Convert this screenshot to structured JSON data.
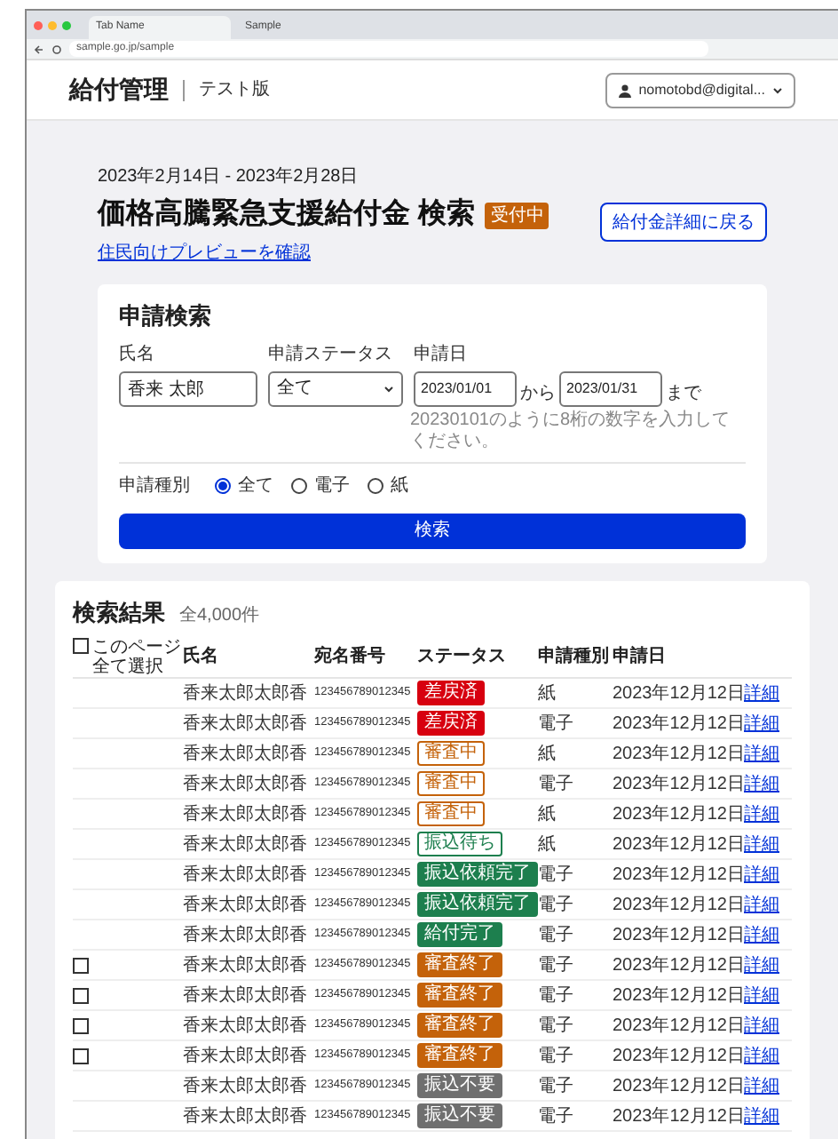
{
  "browser": {
    "tabs": [
      {
        "label": "Tab Name",
        "selected": true
      },
      {
        "label": "Sample",
        "selected": false
      }
    ],
    "url": "sample.go.jp/sample"
  },
  "header": {
    "app_title": "給付管理",
    "edition": "テスト版",
    "user": "nomotobd@digital..."
  },
  "page": {
    "period": "2023年2月14日 - 2023年2月28日",
    "title": "価格高騰緊急支援給付金 検索",
    "badge": "受付中",
    "preview_link": "住民向けプレビューを確認",
    "back_button": "給付金詳細に戻る"
  },
  "search": {
    "title": "申請検索",
    "name_label": "氏名",
    "name_value": "香来 太郎",
    "status_label": "申請ステータス",
    "status_value": "全て",
    "date_label": "申請日",
    "date_from": "2023/01/01",
    "from_text": "から",
    "date_to": "2023/01/31",
    "to_text": "まで",
    "hint": "20230101のように8桁の数字を入力してください。",
    "type_label": "申請種別",
    "type_options": [
      {
        "label": "全て",
        "selected": true
      },
      {
        "label": "電子",
        "selected": false
      },
      {
        "label": "紙",
        "selected": false
      }
    ],
    "submit": "検索"
  },
  "results": {
    "title": "検索結果",
    "count": "全4,000件",
    "select_all": "このページ全て選択",
    "select_all_checked": false,
    "columns": [
      "氏名",
      "宛名番号",
      "ステータス",
      "申請種別",
      "申請日"
    ],
    "rows": [
      {
        "name": "香来太郎太郎香",
        "number": "123456789012345",
        "status": "差戻済",
        "color": "#d7000f",
        "filled": true,
        "type": "紙",
        "date": "2023年12月12日",
        "link": "詳細"
      },
      {
        "name": "香来太郎太郎香",
        "number": "123456789012345",
        "status": "差戻済",
        "color": "#d7000f",
        "filled": true,
        "type": "電子",
        "date": "2023年12月12日",
        "link": "詳細"
      },
      {
        "name": "香来太郎太郎香",
        "number": "123456789012345",
        "status": "審査中",
        "color": "#c4620a",
        "filled": false,
        "type": "紙",
        "date": "2023年12月12日",
        "link": "詳細"
      },
      {
        "name": "香来太郎太郎香",
        "number": "123456789012345",
        "status": "審査中",
        "color": "#c4620a",
        "filled": false,
        "type": "電子",
        "date": "2023年12月12日",
        "link": "詳細"
      },
      {
        "name": "香来太郎太郎香",
        "number": "123456789012345",
        "status": "審査中",
        "color": "#c4620a",
        "filled": false,
        "type": "紙",
        "date": "2023年12月12日",
        "link": "詳細"
      },
      {
        "name": "香来太郎太郎香",
        "number": "123456789012345",
        "status": "振込待ち",
        "color": "#1d7f4e",
        "filled": false,
        "type": "紙",
        "date": "2023年12月12日",
        "link": "詳細"
      },
      {
        "name": "香来太郎太郎香",
        "number": "123456789012345",
        "status": "振込依頼完了",
        "color": "#1d7f4e",
        "filled": true,
        "type": "電子",
        "date": "2023年12月12日",
        "link": "詳細"
      },
      {
        "name": "香来太郎太郎香",
        "number": "123456789012345",
        "status": "振込依頼完了",
        "color": "#1d7f4e",
        "filled": true,
        "type": "電子",
        "date": "2023年12月12日",
        "link": "詳細"
      },
      {
        "name": "香来太郎太郎香",
        "number": "123456789012345",
        "status": "給付完了",
        "color": "#1d7f4e",
        "filled": true,
        "type": "電子",
        "date": "2023年12月12日",
        "link": "詳細"
      },
      {
        "name": "香来太郎太郎香",
        "number": "123456789012345",
        "status": "審査終了",
        "color": "#c4620a",
        "filled": true,
        "type": "電子",
        "date": "2023年12月12日",
        "link": "詳細",
        "checked": false
      },
      {
        "name": "香来太郎太郎香",
        "number": "123456789012345",
        "status": "審査終了",
        "color": "#c4620a",
        "filled": true,
        "type": "電子",
        "date": "2023年12月12日",
        "link": "詳細",
        "checked": false
      },
      {
        "name": "香来太郎太郎香",
        "number": "123456789012345",
        "status": "審査終了",
        "color": "#c4620a",
        "filled": true,
        "type": "電子",
        "date": "2023年12月12日",
        "link": "詳細",
        "checked": false
      },
      {
        "name": "香来太郎太郎香",
        "number": "123456789012345",
        "status": "審査終了",
        "color": "#c4620a",
        "filled": true,
        "type": "電子",
        "date": "2023年12月12日",
        "link": "詳細",
        "checked": false
      },
      {
        "name": "香来太郎太郎香",
        "number": "123456789012345",
        "status": "振込不要",
        "color": "#6f6f6f",
        "filled": true,
        "type": "電子",
        "date": "2023年12月12日",
        "link": "詳細"
      },
      {
        "name": "香来太郎太郎香",
        "number": "123456789012345",
        "status": "振込不要",
        "color": "#6f6f6f",
        "filled": true,
        "type": "電子",
        "date": "2023年12月12日",
        "link": "詳細"
      }
    ]
  }
}
